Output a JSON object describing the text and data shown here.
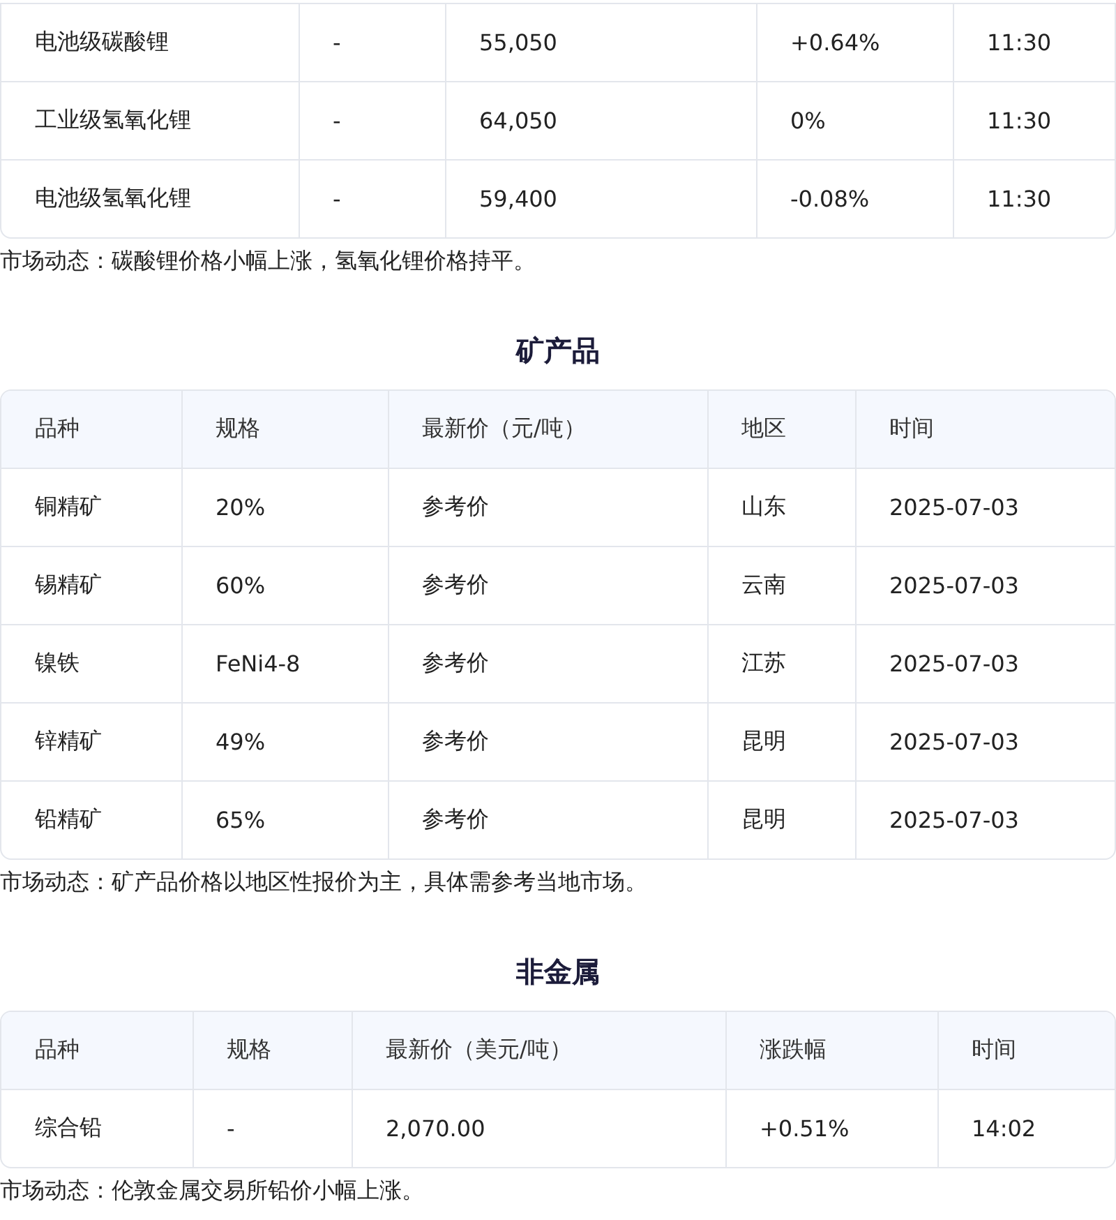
{
  "sections": [
    {
      "rows": [
        [
          "电池级碳酸锂",
          "-",
          "55,050",
          "+0.64%",
          "11:30"
        ],
        [
          "工业级氢氧化锂",
          "-",
          "64,050",
          "0%",
          "11:30"
        ],
        [
          "电池级氢氧化锂",
          "-",
          "59,400",
          "-0.08%",
          "11:30"
        ]
      ],
      "note": "市场动态：碳酸锂价格小幅上涨，氢氧化锂价格持平。"
    },
    {
      "title": "矿产品",
      "columns": [
        "品种",
        "规格",
        "最新价（元/吨）",
        "地区",
        "时间"
      ],
      "rows": [
        [
          "铜精矿",
          "20%",
          "参考价",
          "山东",
          "2025-07-03"
        ],
        [
          "锡精矿",
          "60%",
          "参考价",
          "云南",
          "2025-07-03"
        ],
        [
          "镍铁",
          "FeNi4-8",
          "参考价",
          "江苏",
          "2025-07-03"
        ],
        [
          "锌精矿",
          "49%",
          "参考价",
          "昆明",
          "2025-07-03"
        ],
        [
          "铅精矿",
          "65%",
          "参考价",
          "昆明",
          "2025-07-03"
        ]
      ],
      "note": "市场动态：矿产品价格以地区性报价为主，具体需参考当地市场。"
    },
    {
      "title": "非金属",
      "columns": [
        "品种",
        "规格",
        "最新价（美元/吨）",
        "涨跌幅",
        "时间"
      ],
      "rows": [
        [
          "综合铅",
          "-",
          "2,070.00",
          "+0.51%",
          "14:02"
        ]
      ],
      "note": "市场动态：伦敦金属交易所铅价小幅上涨。"
    }
  ]
}
